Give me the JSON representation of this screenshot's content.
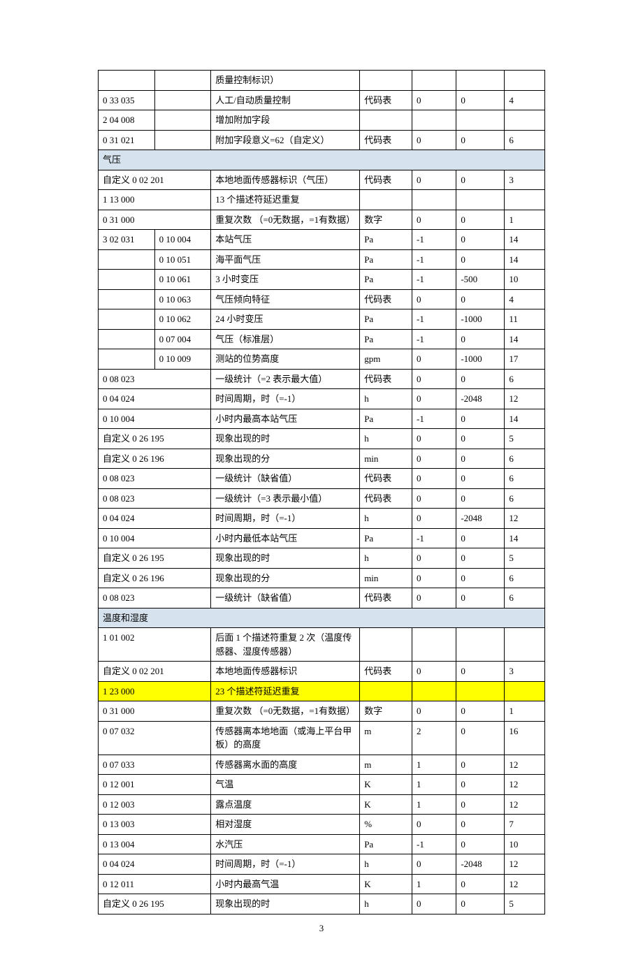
{
  "rows": [
    {
      "type": "row",
      "c1": "",
      "c2": "",
      "c3": "质量控制标识）",
      "c4": "",
      "c5": "",
      "c6": "",
      "c7": ""
    },
    {
      "type": "row",
      "c1": "0 33 035",
      "c2": "",
      "c3": "人工/自动质量控制",
      "c4": "代码表",
      "c5": "0",
      "c6": "0",
      "c7": "4"
    },
    {
      "type": "row",
      "c1": "2 04 008",
      "c2": "",
      "c3": "增加附加字段",
      "c4": "",
      "c5": "",
      "c6": "",
      "c7": ""
    },
    {
      "type": "row",
      "c1": "0 31 021",
      "c2": "",
      "c3": "附加字段意义=62（自定义）",
      "c4": "代码表",
      "c5": "0",
      "c6": "0",
      "c7": "6"
    },
    {
      "type": "section",
      "text": "气压"
    },
    {
      "type": "row",
      "c1": "自定义 0 02 201",
      "c2": "",
      "c3": "本地地面传感器标识（气压）",
      "c4": "代码表",
      "c5": "0",
      "c6": "0",
      "c7": "3",
      "merge12": true
    },
    {
      "type": "row",
      "c1": "1 13 000",
      "c2": "",
      "c3": "13 个描述符延迟重复",
      "c4": "",
      "c5": "",
      "c6": "",
      "c7": "",
      "merge12": true
    },
    {
      "type": "row",
      "c1": "0 31 000",
      "c2": "",
      "c3": "重复次数 （=0无数据，=1有数据）",
      "c4": "数字",
      "c5": "0",
      "c6": "0",
      "c7": "1",
      "merge12": true
    },
    {
      "type": "row",
      "c1": "3 02 031",
      "c2": "0 10 004",
      "c3": "本站气压",
      "c4": "Pa",
      "c5": "-1",
      "c6": "0",
      "c7": "14"
    },
    {
      "type": "row",
      "c1": "",
      "c2": "0 10 051",
      "c3": "海平面气压",
      "c4": "Pa",
      "c5": "-1",
      "c6": "0",
      "c7": "14"
    },
    {
      "type": "row",
      "c1": "",
      "c2": "0 10 061",
      "c3": "3 小时变压",
      "c4": "Pa",
      "c5": "-1",
      "c6": "-500",
      "c7": "10"
    },
    {
      "type": "row",
      "c1": "",
      "c2": "0 10 063",
      "c3": "气压倾向特征",
      "c4": "代码表",
      "c5": "0",
      "c6": "0",
      "c7": "4"
    },
    {
      "type": "row",
      "c1": "",
      "c2": "0 10 062",
      "c3": "24 小时变压",
      "c4": "Pa",
      "c5": "-1",
      "c6": "-1000",
      "c7": "11"
    },
    {
      "type": "row",
      "c1": "",
      "c2": "0 07 004",
      "c3": "气压（标准层）",
      "c4": "Pa",
      "c5": "-1",
      "c6": "0",
      "c7": "14"
    },
    {
      "type": "row",
      "c1": "",
      "c2": "0 10 009",
      "c3": "测站的位势高度",
      "c4": "gpm",
      "c5": "0",
      "c6": "-1000",
      "c7": "17"
    },
    {
      "type": "row",
      "c1": "0 08 023",
      "c2": "",
      "c3": "一级统计（=2 表示最大值）",
      "c4": "代码表",
      "c5": "0",
      "c6": "0",
      "c7": "6",
      "merge12": true
    },
    {
      "type": "row",
      "c1": "0 04 024",
      "c2": "",
      "c3": "时间周期，时（=-1）",
      "c4": "h",
      "c5": "0",
      "c6": "-2048",
      "c7": "12",
      "merge12": true
    },
    {
      "type": "row",
      "c1": "0 10 004",
      "c2": "",
      "c3": "小时内最高本站气压",
      "c4": "Pa",
      "c5": "-1",
      "c6": "0",
      "c7": "14",
      "merge12": true
    },
    {
      "type": "row",
      "c1": "自定义 0 26 195",
      "c2": "",
      "c3": "现象出现的时",
      "c4": "h",
      "c5": "0",
      "c6": "0",
      "c7": "5",
      "merge12": true
    },
    {
      "type": "row",
      "c1": "自定义 0 26 196",
      "c2": "",
      "c3": "现象出现的分",
      "c4": "min",
      "c5": "0",
      "c6": "0",
      "c7": "6",
      "merge12": true
    },
    {
      "type": "row",
      "c1": "0 08 023",
      "c2": "",
      "c3": "一级统计（缺省值）",
      "c4": "代码表",
      "c5": "0",
      "c6": "0",
      "c7": "6",
      "merge12": true
    },
    {
      "type": "row",
      "c1": "0 08 023",
      "c2": "",
      "c3": "一级统计（=3 表示最小值）",
      "c4": "代码表",
      "c5": "0",
      "c6": "0",
      "c7": "6",
      "merge12": true
    },
    {
      "type": "row",
      "c1": "0 04 024",
      "c2": "",
      "c3": "时间周期，时（=-1）",
      "c4": "h",
      "c5": "0",
      "c6": "-2048",
      "c7": "12",
      "merge12": true
    },
    {
      "type": "row",
      "c1": "0 10 004",
      "c2": "",
      "c3": "小时内最低本站气压",
      "c4": "Pa",
      "c5": "-1",
      "c6": "0",
      "c7": "14",
      "merge12": true
    },
    {
      "type": "row",
      "c1": "自定义 0 26 195",
      "c2": "",
      "c3": "现象出现的时",
      "c4": "h",
      "c5": "0",
      "c6": "0",
      "c7": "5",
      "merge12": true
    },
    {
      "type": "row",
      "c1": "自定义 0 26 196",
      "c2": "",
      "c3": "现象出现的分",
      "c4": "min",
      "c5": "0",
      "c6": "0",
      "c7": "6",
      "merge12": true
    },
    {
      "type": "row",
      "c1": "0 08 023",
      "c2": "",
      "c3": "一级统计（缺省值）",
      "c4": "代码表",
      "c5": "0",
      "c6": "0",
      "c7": "6",
      "merge12": true
    },
    {
      "type": "section",
      "text": "温度和湿度"
    },
    {
      "type": "row",
      "c1": "1 01 002",
      "c2": "",
      "c3": "后面 1 个描述符重复 2 次（温度传感器、湿度传感器）",
      "c4": "",
      "c5": "",
      "c6": "",
      "c7": "",
      "merge12": true
    },
    {
      "type": "row",
      "c1": "自定义 0 02 201",
      "c2": "",
      "c3": "本地地面传感器标识",
      "c4": "代码表",
      "c5": "0",
      "c6": "0",
      "c7": "3",
      "merge12": true
    },
    {
      "type": "hl",
      "c1": "1 23 000",
      "c2": "",
      "c3": "23 个描述符延迟重复",
      "c4": "",
      "c5": "",
      "c6": "",
      "c7": "",
      "merge12": true
    },
    {
      "type": "row",
      "c1": "0 31 000",
      "c2": "",
      "c3": "重复次数 （=0无数据，=1有数据）",
      "c4": "数字",
      "c5": "0",
      "c6": "0",
      "c7": "1",
      "merge12": true
    },
    {
      "type": "row",
      "c1": "0 07 032",
      "c2": "",
      "c3": "传感器离本地地面（或海上平台甲板）的高度",
      "c4": "m",
      "c5": "2",
      "c6": "0",
      "c7": "16",
      "merge12": true
    },
    {
      "type": "row",
      "c1": "0 07 033",
      "c2": "",
      "c3": "传感器离水面的高度",
      "c4": "m",
      "c5": "1",
      "c6": "0",
      "c7": "12",
      "merge12": true
    },
    {
      "type": "row",
      "c1": "0 12 001",
      "c2": "",
      "c3": "气温",
      "c4": "K",
      "c5": "1",
      "c6": "0",
      "c7": "12",
      "merge12": true
    },
    {
      "type": "row",
      "c1": "0 12 003",
      "c2": "",
      "c3": "露点温度",
      "c4": "K",
      "c5": "1",
      "c6": "0",
      "c7": "12",
      "merge12": true
    },
    {
      "type": "row",
      "c1": "0 13 003",
      "c2": "",
      "c3": "相对湿度",
      "c4": "%",
      "c5": "0",
      "c6": "0",
      "c7": "7",
      "merge12": true
    },
    {
      "type": "row",
      "c1": "0 13 004",
      "c2": "",
      "c3": "水汽压",
      "c4": "Pa",
      "c5": "-1",
      "c6": "0",
      "c7": "10",
      "merge12": true
    },
    {
      "type": "row",
      "c1": "0 04 024",
      "c2": "",
      "c3": "时间周期，时（=-1）",
      "c4": "h",
      "c5": "0",
      "c6": "-2048",
      "c7": "12",
      "merge12": true
    },
    {
      "type": "row",
      "c1": "0 12 011",
      "c2": "",
      "c3": "小时内最高气温",
      "c4": "K",
      "c5": "1",
      "c6": "0",
      "c7": "12",
      "merge12": true
    },
    {
      "type": "row",
      "c1": "自定义 0 26 195",
      "c2": "",
      "c3": "现象出现的时",
      "c4": "h",
      "c5": "0",
      "c6": "0",
      "c7": "5",
      "merge12": true
    }
  ],
  "footer": "3"
}
